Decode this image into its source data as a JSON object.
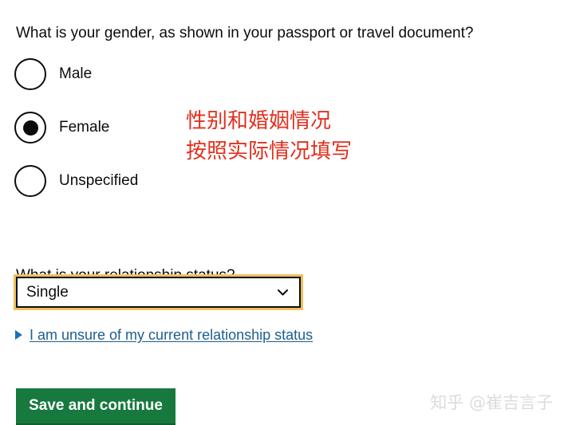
{
  "form": {
    "gender": {
      "heading": "What is your gender, as shown in your passport or travel document?",
      "options": [
        {
          "label": "Male",
          "selected": false
        },
        {
          "label": "Female",
          "selected": true
        },
        {
          "label": "Unspecified",
          "selected": false
        }
      ]
    },
    "relationship": {
      "heading": "What is your relationship status?",
      "selected_value": "Single",
      "details_link": "I am unsure of my current relationship status"
    },
    "submit_label": "Save and continue"
  },
  "annotation": {
    "line1": "性别和婚姻情况",
    "line2": "按照实际情况填写",
    "color": "#e0301e"
  },
  "watermark": {
    "text": "知乎 @崔吉言子"
  },
  "colors": {
    "text": "#0b0c0c",
    "link": "#1d5d90",
    "focus_ring": "#efbf5b",
    "button_green": "#17793e",
    "annotation_red": "#e0301e",
    "watermark_gray": "#dcdcdc"
  }
}
